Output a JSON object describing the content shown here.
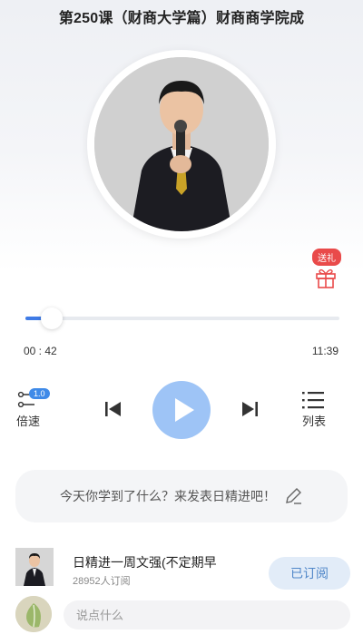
{
  "header": {
    "title": "第250课（财商大学篇）财商商学院成"
  },
  "gift": {
    "badge_label": "送礼",
    "icon": "gift-icon",
    "accent": "#e94a4a"
  },
  "player": {
    "current_time": "00 : 42",
    "total_time": "11:39",
    "progress_fraction": 0.06,
    "speed_value": "1.0",
    "speed_label": "倍速",
    "list_label": "列表",
    "accent": "#3f7be6"
  },
  "comment_prompt": {
    "text": "今天你学到了什么？来发表日精进吧！",
    "icon": "pencil-icon"
  },
  "subscription": {
    "title": "日精进一周文强(不定期早",
    "count": "28952人订阅",
    "button_label": "已订阅"
  },
  "comment_input": {
    "placeholder": "说点什么"
  }
}
